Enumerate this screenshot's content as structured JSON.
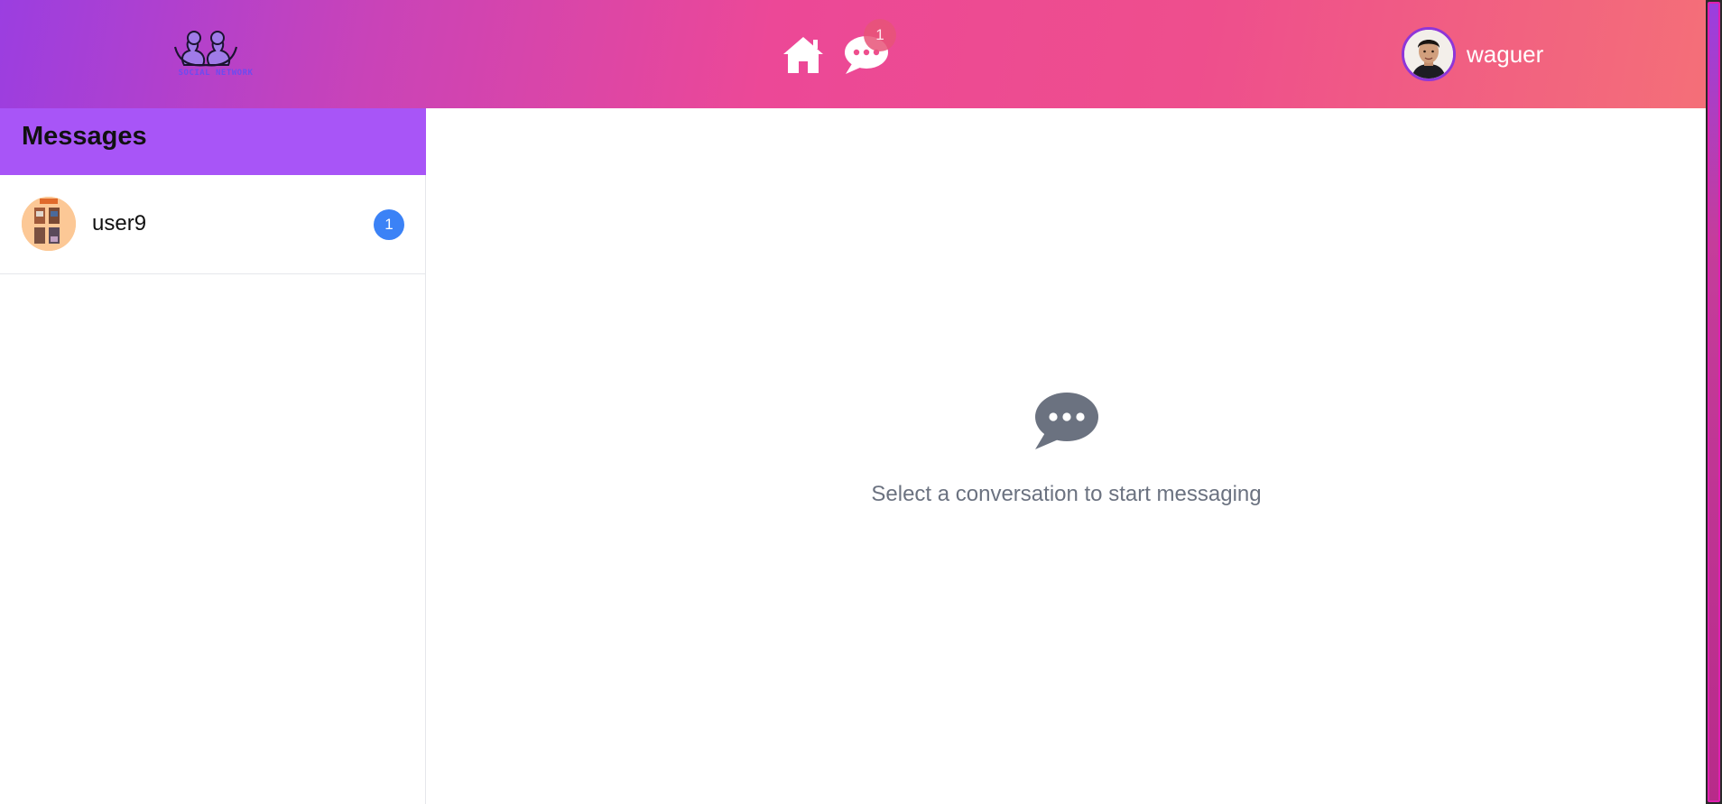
{
  "header": {
    "logo_text": "SOCIAL NETWORK",
    "nav": {
      "home_icon": "home-icon",
      "messages_icon": "chat-bubble-icon",
      "messages_badge": "1"
    },
    "user": {
      "name": "waguer"
    },
    "gradient": [
      "#9b3ee0",
      "#ec4897",
      "#f46f78"
    ]
  },
  "sidebar": {
    "title": "Messages",
    "accent": "#a855f7",
    "conversations": [
      {
        "name": "user9",
        "unread": "1"
      }
    ]
  },
  "main": {
    "empty_icon": "chat-bubble-icon",
    "empty_text": "Select a conversation to start messaging"
  }
}
